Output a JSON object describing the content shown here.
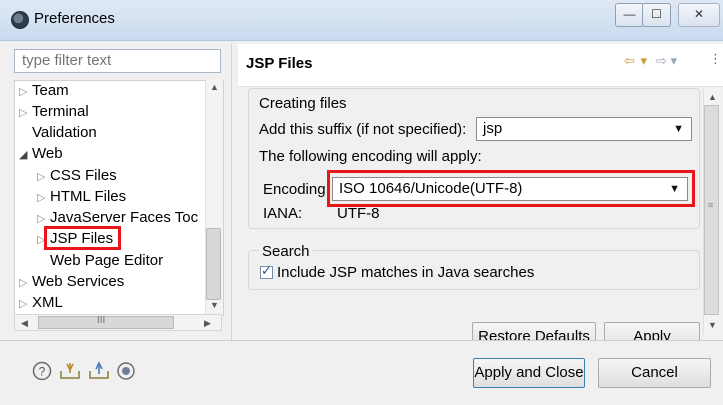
{
  "window": {
    "title": "Preferences",
    "controls": {
      "minimize": "—",
      "maximize": "☐",
      "close": "✕"
    }
  },
  "left": {
    "filter_placeholder": "type filter text",
    "tree": [
      {
        "label": "Team",
        "expander": "▷"
      },
      {
        "label": "Terminal",
        "expander": "▷"
      },
      {
        "label": "Validation",
        "expander": ""
      },
      {
        "label": "Web",
        "expander": "◢"
      },
      {
        "label": "CSS Files",
        "expander": "▷"
      },
      {
        "label": "HTML Files",
        "expander": "▷"
      },
      {
        "label": "JavaServer Faces Toc",
        "expander": "▷"
      },
      {
        "label": "JSP Files",
        "expander": "▷"
      },
      {
        "label": "Web Page Editor",
        "expander": ""
      },
      {
        "label": "Web Services",
        "expander": "▷"
      },
      {
        "label": "XML",
        "expander": "▷"
      }
    ],
    "hscroll_grip": "III"
  },
  "page": {
    "title": "JSP Files",
    "creating_files": {
      "heading": "Creating files",
      "suffix_label": "Add this suffix (if not specified):",
      "suffix_value": "jsp",
      "encoding_intro": "The following encoding will apply:",
      "encoding_label": "Encoding",
      "encoding_value": "ISO 10646/Unicode(UTF-8)",
      "iana_label": "IANA:",
      "iana_value": "UTF-8"
    },
    "search": {
      "heading": "Search",
      "include_label": "Include JSP matches in Java searches",
      "include_checked": true
    },
    "restore_defaults": "Restore Defaults",
    "apply": "Apply"
  },
  "footer": {
    "apply_close": "Apply and Close",
    "cancel": "Cancel",
    "icons": [
      "help-icon",
      "import-icon",
      "export-icon",
      "record-icon"
    ]
  },
  "colors": {
    "highlight": "#e8151b",
    "title_bar": "#d5e2f1"
  }
}
